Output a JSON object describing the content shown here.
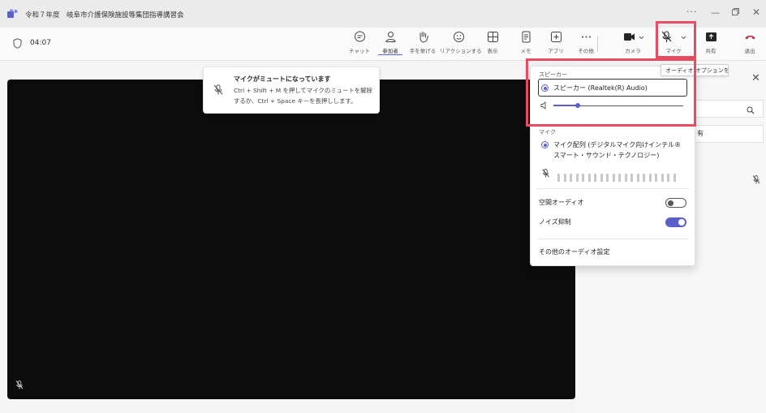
{
  "window": {
    "title": "令和７年度　岐阜市介護保険施設等集団指導講習会",
    "more_label": "···"
  },
  "toolbar": {
    "timer": "04:07",
    "buttons": [
      {
        "label": "チャット",
        "icon": "chat-icon"
      },
      {
        "label": "参加者",
        "icon": "people-icon"
      },
      {
        "label": "手を挙げる",
        "icon": "raise-hand-icon"
      },
      {
        "label": "リアクションする",
        "icon": "reaction-icon"
      },
      {
        "label": "表示",
        "icon": "view-icon"
      },
      {
        "label": "メモ",
        "icon": "notes-icon"
      },
      {
        "label": "アプリ",
        "icon": "apps-icon"
      },
      {
        "label": "その他",
        "icon": "more-icon"
      },
      {
        "label": "カメラ",
        "icon": "camera-icon"
      },
      {
        "label": "マイク",
        "icon": "mic-off-icon"
      },
      {
        "label": "共有",
        "icon": "share-icon"
      },
      {
        "label": "退出",
        "icon": "leave-icon"
      }
    ]
  },
  "toast": {
    "title": "マイクがミュートになっています",
    "body": "Ctrl + Shift + M を押してマイクのミュートを解除するか、Ctrl + Space キーを長押しします。"
  },
  "tooltip": "オーディオ オプションを開く",
  "panel": {
    "share_text": "有"
  },
  "audio_popover": {
    "speaker_section": "スピーカー",
    "speaker_device": "スピーカー (Realtek(R) Audio)",
    "speaker_volume_fraction": 0.2,
    "mic_section": "マイク",
    "mic_device_line1": "マイク配列 (デジタルマイク向けインテル®",
    "mic_device_line2": "スマート・サウンド・テクノロジー)",
    "spatial_audio_label": "空間オーディオ",
    "spatial_audio_on": false,
    "noise_suppression_label": "ノイズ抑制",
    "noise_suppression_on": true,
    "more_settings_label": "その他のオーディオ設定"
  },
  "colors": {
    "accent": "#5b5fc7",
    "highlight": "#e84c63",
    "leave": "#c4314b"
  }
}
